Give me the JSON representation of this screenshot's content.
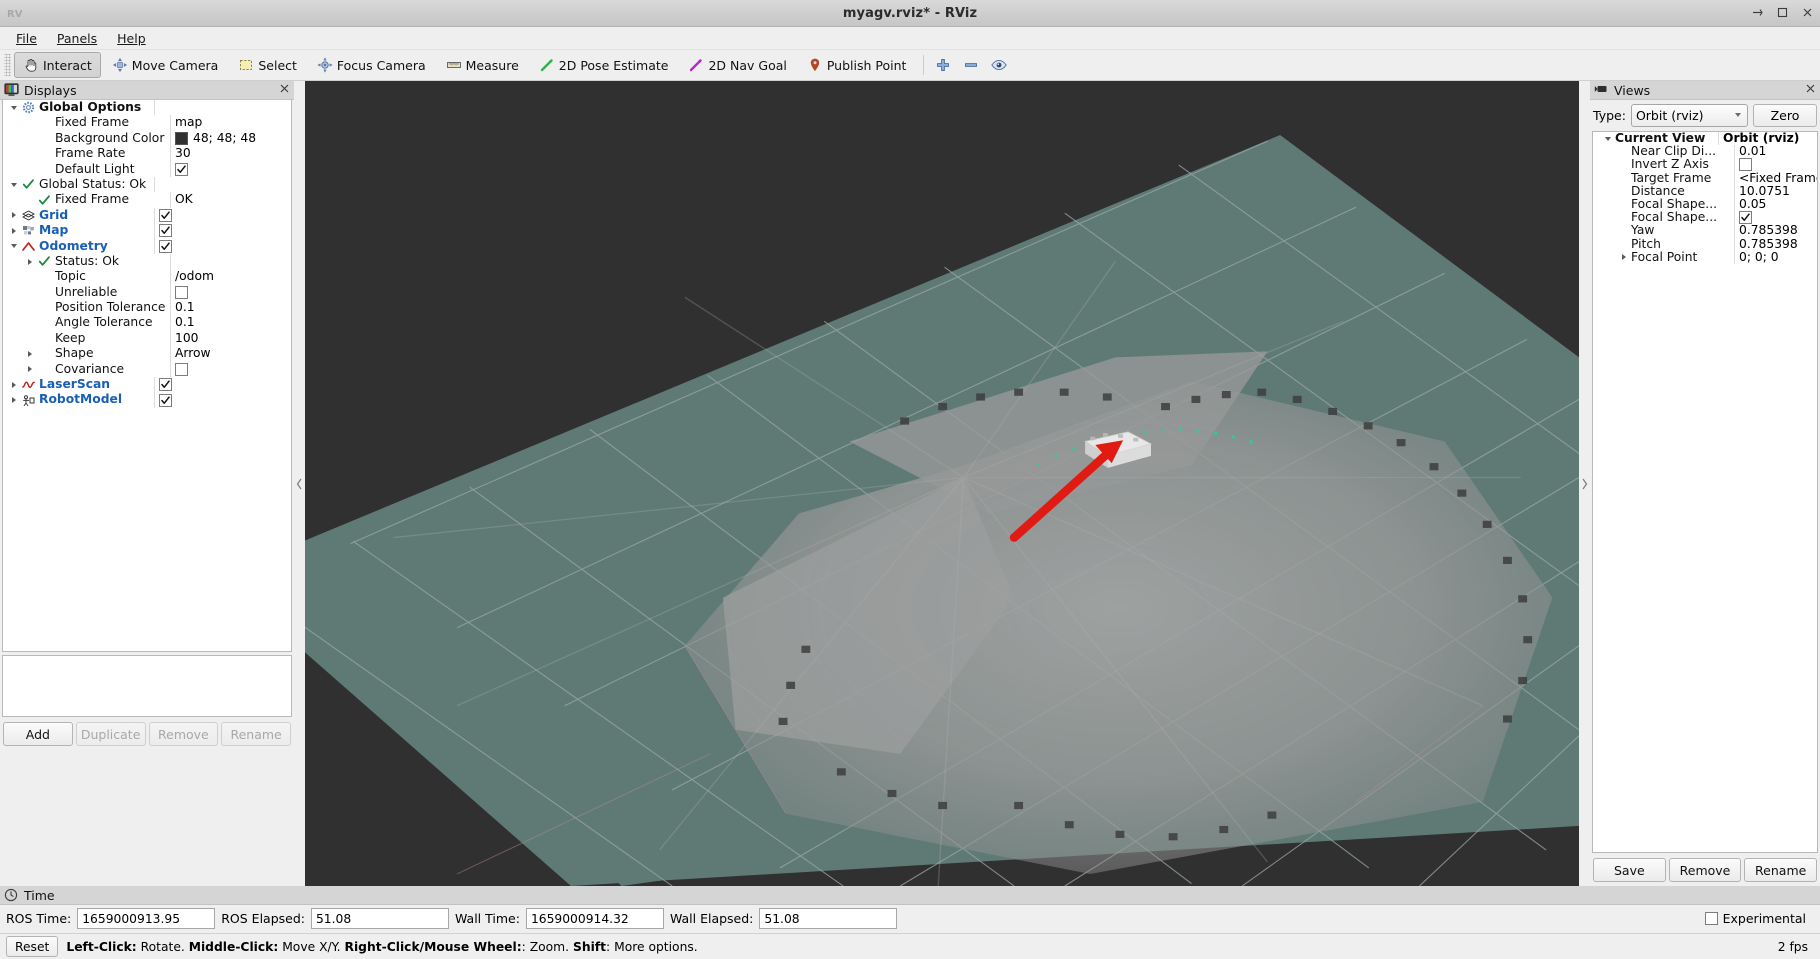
{
  "window": {
    "title": "myagv.rviz* - RViz",
    "controls": [
      "minimize",
      "maximize",
      "close"
    ]
  },
  "menubar": {
    "items": [
      {
        "label": "File",
        "mnemonic": "F"
      },
      {
        "label": "Panels",
        "mnemonic": "P"
      },
      {
        "label": "Help",
        "mnemonic": "H"
      }
    ]
  },
  "toolbar": {
    "tools": [
      {
        "label": "Interact",
        "icon": "hand-cursor-icon",
        "active": true
      },
      {
        "label": "Move Camera",
        "icon": "move-camera-icon",
        "active": false
      },
      {
        "label": "Select",
        "icon": "select-rect-icon",
        "active": false
      },
      {
        "label": "Focus Camera",
        "icon": "focus-camera-icon",
        "active": false
      },
      {
        "label": "Measure",
        "icon": "ruler-icon",
        "active": false
      },
      {
        "label": "2D Pose Estimate",
        "icon": "pose-estimate-arrow-icon",
        "active": false
      },
      {
        "label": "2D Nav Goal",
        "icon": "nav-goal-arrow-icon",
        "active": false
      },
      {
        "label": "Publish Point",
        "icon": "map-pin-icon",
        "active": false
      }
    ],
    "icon_buttons": [
      {
        "name": "add-tool-icon",
        "glyph": "+"
      },
      {
        "name": "remove-tool-icon",
        "glyph": "−"
      },
      {
        "name": "visibility-eye-icon",
        "glyph": "eye"
      }
    ]
  },
  "displays_panel": {
    "title": "Displays",
    "icon": "displays-icon",
    "close_icon": "×",
    "rows": [
      {
        "indent": 0,
        "twisty": "open",
        "icon": "gear-icon",
        "label": "Global Options",
        "style": "bold",
        "value": "",
        "value_type": "text"
      },
      {
        "indent": 1,
        "twisty": "none",
        "icon": "none",
        "label": "Fixed Frame",
        "style": "plain",
        "value": "map",
        "value_type": "text"
      },
      {
        "indent": 1,
        "twisty": "none",
        "icon": "none",
        "label": "Background Color",
        "style": "plain",
        "value": "48; 48; 48",
        "value_type": "color",
        "color": "#303030"
      },
      {
        "indent": 1,
        "twisty": "none",
        "icon": "none",
        "label": "Frame Rate",
        "style": "plain",
        "value": "30",
        "value_type": "text"
      },
      {
        "indent": 1,
        "twisty": "none",
        "icon": "none",
        "label": "Default Light",
        "style": "plain",
        "value": "checked",
        "value_type": "checkbox"
      },
      {
        "indent": 0,
        "twisty": "open",
        "icon": "check-icon",
        "label": "Global Status: Ok",
        "style": "plain",
        "value": "",
        "value_type": "text"
      },
      {
        "indent": 1,
        "twisty": "none",
        "icon": "check-icon",
        "label": "Fixed Frame",
        "style": "plain",
        "value": "OK",
        "value_type": "text"
      },
      {
        "indent": 0,
        "twisty": "closed",
        "icon": "grid-icon",
        "label": "Grid",
        "style": "blue",
        "value": "checked",
        "value_type": "checkbox"
      },
      {
        "indent": 0,
        "twisty": "closed",
        "icon": "map-icon",
        "label": "Map",
        "style": "blue",
        "value": "checked",
        "value_type": "checkbox"
      },
      {
        "indent": 0,
        "twisty": "open",
        "icon": "odometry-icon",
        "label": "Odometry",
        "style": "blue",
        "value": "checked",
        "value_type": "checkbox"
      },
      {
        "indent": 1,
        "twisty": "closed",
        "icon": "check-icon",
        "label": "Status: Ok",
        "style": "plain",
        "value": "",
        "value_type": "text"
      },
      {
        "indent": 1,
        "twisty": "none",
        "icon": "none",
        "label": "Topic",
        "style": "plain",
        "value": "/odom",
        "value_type": "text"
      },
      {
        "indent": 1,
        "twisty": "none",
        "icon": "none",
        "label": "Unreliable",
        "style": "plain",
        "value": "unchecked",
        "value_type": "checkbox"
      },
      {
        "indent": 1,
        "twisty": "none",
        "icon": "none",
        "label": "Position Tolerance",
        "style": "plain",
        "value": "0.1",
        "value_type": "text"
      },
      {
        "indent": 1,
        "twisty": "none",
        "icon": "none",
        "label": "Angle Tolerance",
        "style": "plain",
        "value": "0.1",
        "value_type": "text"
      },
      {
        "indent": 1,
        "twisty": "none",
        "icon": "none",
        "label": "Keep",
        "style": "plain",
        "value": "100",
        "value_type": "text"
      },
      {
        "indent": 1,
        "twisty": "closed",
        "icon": "none",
        "label": "Shape",
        "style": "plain",
        "value": "Arrow",
        "value_type": "text"
      },
      {
        "indent": 1,
        "twisty": "closed",
        "icon": "none",
        "label": "Covariance",
        "style": "plain",
        "value": "unchecked",
        "value_type": "checkbox"
      },
      {
        "indent": 0,
        "twisty": "closed",
        "icon": "laserscan-icon",
        "label": "LaserScan",
        "style": "blue",
        "value": "checked",
        "value_type": "checkbox"
      },
      {
        "indent": 0,
        "twisty": "closed",
        "icon": "robotmodel-icon",
        "label": "RobotModel",
        "style": "blue",
        "value": "checked",
        "value_type": "checkbox"
      }
    ],
    "buttons": [
      {
        "label": "Add",
        "enabled": true
      },
      {
        "label": "Duplicate",
        "enabled": false
      },
      {
        "label": "Remove",
        "enabled": false
      },
      {
        "label": "Rename",
        "enabled": false
      }
    ]
  },
  "views_panel": {
    "title": "Views",
    "icon": "views-camera-icon",
    "close_icon": "×",
    "type_label": "Type:",
    "type_value": "Orbit (rviz)",
    "zero_button": "Zero",
    "rows": [
      {
        "indent": 0,
        "twisty": "open",
        "label": "Current View",
        "style": "bold",
        "value": "Orbit (rviz)",
        "value_type": "text",
        "value_style": "bold"
      },
      {
        "indent": 1,
        "twisty": "none",
        "label": "Near Clip Di...",
        "style": "plain",
        "value": "0.01",
        "value_type": "text"
      },
      {
        "indent": 1,
        "twisty": "none",
        "label": "Invert Z Axis",
        "style": "plain",
        "value": "unchecked",
        "value_type": "checkbox"
      },
      {
        "indent": 1,
        "twisty": "none",
        "label": "Target Frame",
        "style": "plain",
        "value": "<Fixed Frame>",
        "value_type": "text"
      },
      {
        "indent": 1,
        "twisty": "none",
        "label": "Distance",
        "style": "plain",
        "value": "10.0751",
        "value_type": "text"
      },
      {
        "indent": 1,
        "twisty": "none",
        "label": "Focal Shape...",
        "style": "plain",
        "value": "0.05",
        "value_type": "text"
      },
      {
        "indent": 1,
        "twisty": "none",
        "label": "Focal Shape...",
        "style": "plain",
        "value": "checked",
        "value_type": "checkbox"
      },
      {
        "indent": 1,
        "twisty": "none",
        "label": "Yaw",
        "style": "plain",
        "value": "0.785398",
        "value_type": "text"
      },
      {
        "indent": 1,
        "twisty": "none",
        "label": "Pitch",
        "style": "plain",
        "value": "0.785398",
        "value_type": "text"
      },
      {
        "indent": 1,
        "twisty": "closed",
        "label": "Focal Point",
        "style": "plain",
        "value": "0; 0; 0",
        "value_type": "text"
      }
    ],
    "buttons": [
      {
        "label": "Save",
        "enabled": true
      },
      {
        "label": "Remove",
        "enabled": true
      },
      {
        "label": "Rename",
        "enabled": true
      }
    ]
  },
  "time_panel": {
    "title": "Time",
    "icon": "clock-icon",
    "fields": [
      {
        "label": "ROS Time:",
        "value": "1659000913.95"
      },
      {
        "label": "ROS Elapsed:",
        "value": "51.08"
      },
      {
        "label": "Wall Time:",
        "value": "1659000914.32"
      },
      {
        "label": "Wall Elapsed:",
        "value": "51.08"
      }
    ],
    "experimental": {
      "label": "Experimental",
      "checked": false
    }
  },
  "statusbar": {
    "reset_button": "Reset",
    "hints": [
      {
        "bold": "Left-Click:",
        "text": " Rotate. "
      },
      {
        "bold": "Middle-Click:",
        "text": " Move X/Y. "
      },
      {
        "bold": "Right-Click/Mouse Wheel:",
        "text": ": Zoom. "
      },
      {
        "bold": "Shift",
        "text": ": More options."
      }
    ],
    "fps": "2 fps"
  },
  "viewport": {
    "background_color": "#303030",
    "ground_color": "#5f7a75",
    "grid_color": "#9aa8a5",
    "map_occupied_color": "#9c9c9c",
    "odometry_arrow_color": "#e01b14",
    "robot_color": "#e8e8e8",
    "laserscan_color": "#32c8a0"
  }
}
